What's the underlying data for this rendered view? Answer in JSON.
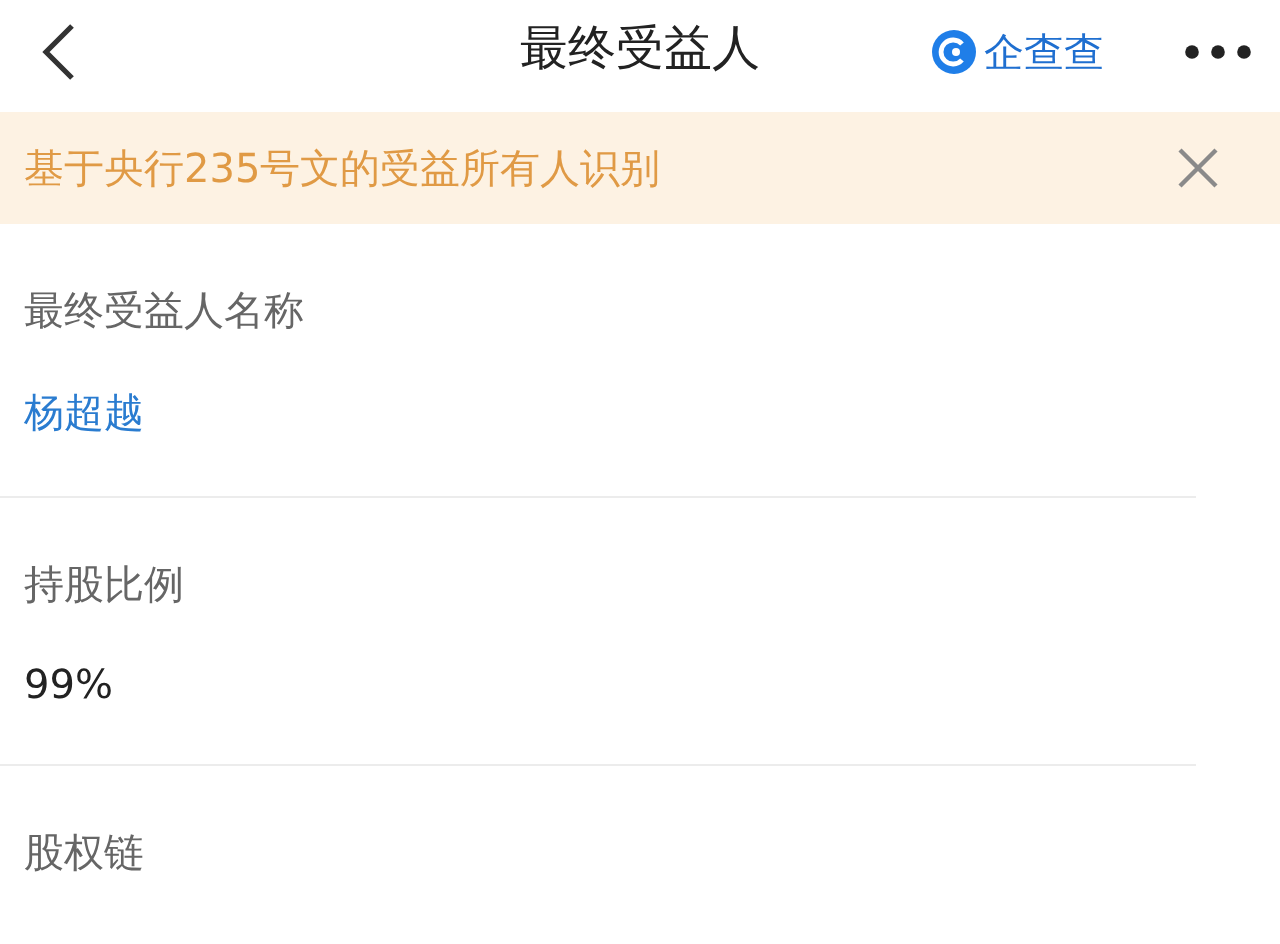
{
  "header": {
    "title": "最终受益人",
    "brand": "企查查"
  },
  "banner": {
    "text": "基于央行235号文的受益所有人识别"
  },
  "fields": [
    {
      "label": "最终受益人名称",
      "value": "杨超越",
      "kind": "link"
    },
    {
      "label": "持股比例",
      "value": "99%",
      "kind": "text"
    },
    {
      "label": "股权链"
    }
  ]
}
